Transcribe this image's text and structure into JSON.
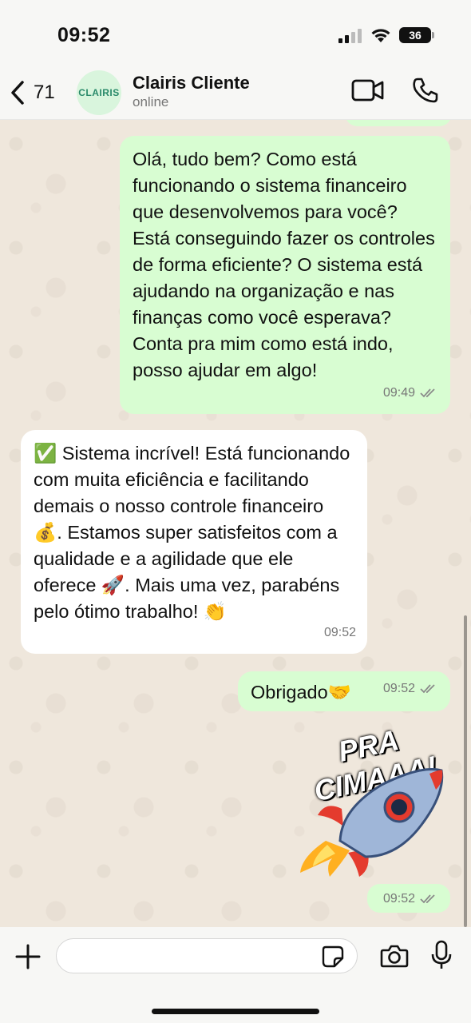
{
  "status_bar": {
    "time": "09:52",
    "battery": "36"
  },
  "header": {
    "back_count": "71",
    "avatar_text": "CLAIRIS",
    "contact_name": "Clairis Cliente",
    "contact_status": "online"
  },
  "messages": [
    {
      "direction": "outgoing",
      "text": "Olá, tudo bem? Como está funcionando o sistema financeiro que desenvolvemos para você? Está conseguindo fazer os controles de forma eficiente? O sistema está ajudando na organização e nas finanças como você esperava? Conta pra mim como está indo, posso ajudar em algo!",
      "time": "09:49",
      "read": true
    },
    {
      "direction": "incoming",
      "text": "✅ Sistema incrível! Está funcionando com muita eficiência e facilitando demais o nosso controle financeiro 💰. Estamos super satisfeitos com a qualidade e a agilidade que ele oferece 🚀. Mais uma vez, parabéns pelo ótimo trabalho! 👏",
      "time": "09:52"
    },
    {
      "direction": "outgoing",
      "text": "Obrigado🤝",
      "time": "09:52",
      "read": true
    },
    {
      "direction": "outgoing",
      "type": "sticker",
      "sticker_text": "PRA CIMAAA!",
      "time": "09:52",
      "read": true
    }
  ],
  "colors": {
    "outgoing_bubble": "#d8fdd2",
    "incoming_bubble": "#ffffff",
    "chat_background": "#efe7dc"
  },
  "icons": [
    "back-chevron-icon",
    "video-call-icon",
    "phone-icon",
    "plus-icon",
    "sticker-icon",
    "camera-icon",
    "microphone-icon",
    "double-check-icon"
  ]
}
